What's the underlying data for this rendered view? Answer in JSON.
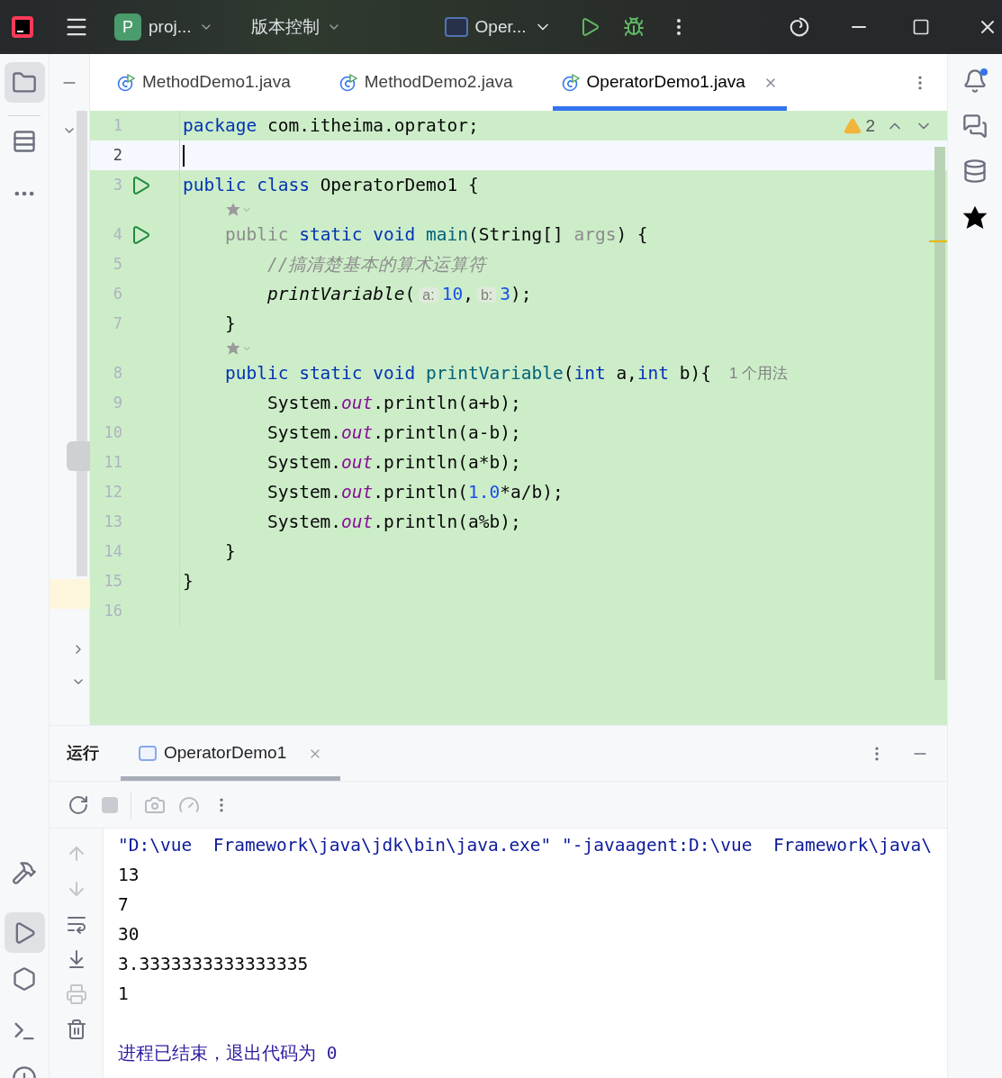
{
  "title_bar": {
    "project_badge": "P",
    "project": "proj...",
    "vcs": "版本控制",
    "run_config": "Oper..."
  },
  "editor_tabs": [
    {
      "label": "MethodDemo1.java",
      "selected": false
    },
    {
      "label": "MethodDemo2.java",
      "selected": false
    },
    {
      "label": "OperatorDemo1.java",
      "selected": true
    }
  ],
  "editor": {
    "warnings": "2",
    "lines": [
      {
        "kind": "code",
        "number": "1",
        "run": false,
        "current": false,
        "tokens": [
          {
            "kind": "keyword",
            "text": "package"
          },
          {
            "kind": "plain",
            "text": " com.itheima.oprator;"
          }
        ]
      },
      {
        "kind": "code",
        "number": "2",
        "run": false,
        "current": true
      },
      {
        "kind": "code",
        "number": "3",
        "run": true,
        "current": false,
        "tokens": [
          {
            "kind": "keyword",
            "text": "public class"
          },
          {
            "kind": "plain",
            "text": " OperatorDemo1 {"
          }
        ]
      },
      {
        "kind": "hint"
      },
      {
        "kind": "code",
        "number": "4",
        "run": true,
        "current": false,
        "tokens": [
          {
            "kind": "muted",
            "text": "    public"
          },
          {
            "kind": "keyword",
            "text": " static void"
          },
          {
            "kind": "fn",
            "text": " main"
          },
          {
            "kind": "plain",
            "text": "(String[] "
          },
          {
            "kind": "muted",
            "text": "args"
          },
          {
            "kind": "plain",
            "text": ") {"
          }
        ]
      },
      {
        "kind": "code",
        "number": "5",
        "run": false,
        "current": false,
        "tokens": [
          {
            "kind": "comment",
            "text": "        //搞清楚基本的算术运算符"
          }
        ]
      },
      {
        "kind": "code",
        "number": "6",
        "run": false,
        "current": false,
        "tokens": [
          {
            "kind": "call",
            "text": "        printVariable"
          },
          {
            "kind": "plain",
            "text": "("
          },
          {
            "kind": "inlay",
            "text": "a:"
          },
          {
            "kind": "number",
            "text": "10"
          },
          {
            "kind": "plain",
            "text": ","
          },
          {
            "kind": "inlay",
            "text": "b:"
          },
          {
            "kind": "number",
            "text": "3"
          },
          {
            "kind": "plain",
            "text": ");"
          }
        ]
      },
      {
        "kind": "code",
        "number": "7",
        "run": false,
        "current": false,
        "tokens": [
          {
            "kind": "plain",
            "text": "    }"
          }
        ]
      },
      {
        "kind": "hint"
      },
      {
        "kind": "code",
        "number": "8",
        "run": false,
        "current": false,
        "usage": "1 个用法",
        "tokens": [
          {
            "kind": "keyword",
            "text": "    public static void"
          },
          {
            "kind": "fn",
            "text": " printVariable"
          },
          {
            "kind": "plain",
            "text": "("
          },
          {
            "kind": "keyword",
            "text": "int"
          },
          {
            "kind": "plain",
            "text": " a,"
          },
          {
            "kind": "keyword",
            "text": "int"
          },
          {
            "kind": "plain",
            "text": " b){"
          }
        ]
      },
      {
        "kind": "code",
        "number": "9",
        "run": false,
        "current": false,
        "tokens": [
          {
            "kind": "plain",
            "text": "        System."
          },
          {
            "kind": "field",
            "text": "out"
          },
          {
            "kind": "plain",
            "text": ".println(a+b);"
          }
        ]
      },
      {
        "kind": "code",
        "number": "10",
        "run": false,
        "current": false,
        "tokens": [
          {
            "kind": "plain",
            "text": "        System."
          },
          {
            "kind": "field",
            "text": "out"
          },
          {
            "kind": "plain",
            "text": ".println(a-b);"
          }
        ]
      },
      {
        "kind": "code",
        "number": "11",
        "run": false,
        "current": false,
        "tokens": [
          {
            "kind": "plain",
            "text": "        System."
          },
          {
            "kind": "field",
            "text": "out"
          },
          {
            "kind": "plain",
            "text": ".println(a*b);"
          }
        ]
      },
      {
        "kind": "code",
        "number": "12",
        "run": false,
        "current": false,
        "tokens": [
          {
            "kind": "plain",
            "text": "        System."
          },
          {
            "kind": "field",
            "text": "out"
          },
          {
            "kind": "plain",
            "text": ".println("
          },
          {
            "kind": "number",
            "text": "1.0"
          },
          {
            "kind": "plain",
            "text": "*a/b);"
          }
        ]
      },
      {
        "kind": "code",
        "number": "13",
        "run": false,
        "current": false,
        "tokens": [
          {
            "kind": "plain",
            "text": "        System."
          },
          {
            "kind": "field",
            "text": "out"
          },
          {
            "kind": "plain",
            "text": ".println(a%b);"
          }
        ]
      },
      {
        "kind": "code",
        "number": "14",
        "run": false,
        "current": false,
        "tokens": [
          {
            "kind": "plain",
            "text": "    }"
          }
        ]
      },
      {
        "kind": "code",
        "number": "15",
        "run": false,
        "current": false,
        "tokens": [
          {
            "kind": "plain",
            "text": "}"
          }
        ]
      },
      {
        "kind": "code",
        "number": "16",
        "run": false,
        "current": false
      }
    ]
  },
  "run_panel": {
    "title": "运行",
    "tab": "OperatorDemo1",
    "output": [
      {
        "kind": "command",
        "text": "\"D:\\vue  Framework\\java\\jdk\\bin\\java.exe\" \"-javaagent:D:\\vue  Framework\\java\\"
      },
      {
        "kind": "stdout",
        "text": "13"
      },
      {
        "kind": "stdout",
        "text": "7"
      },
      {
        "kind": "stdout",
        "text": "30"
      },
      {
        "kind": "stdout",
        "text": "3.3333333333333335"
      },
      {
        "kind": "stdout",
        "text": "1"
      },
      {
        "kind": "exit",
        "text": "进程已结束，退出代码为 0"
      }
    ]
  }
}
